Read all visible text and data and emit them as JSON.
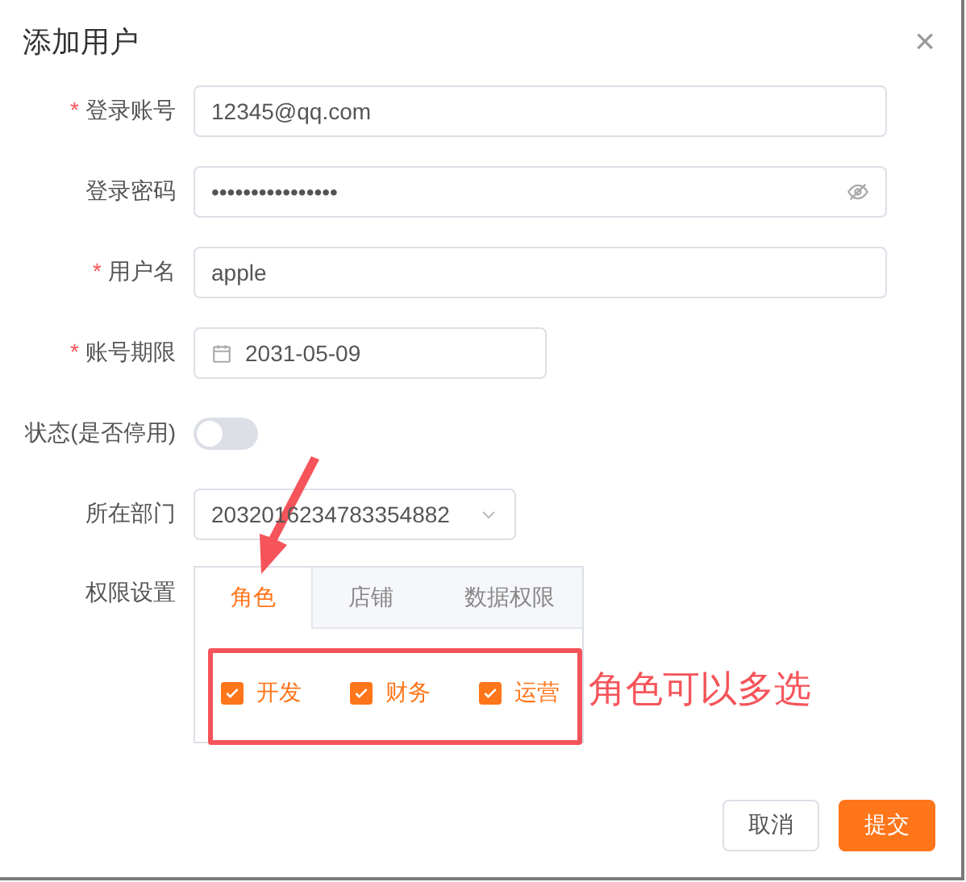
{
  "dialog": {
    "title": "添加用户",
    "close": "×",
    "required_mark": "*"
  },
  "fields": [
    {
      "kind": "text",
      "label": "登录账号",
      "required": true,
      "value": "12345@qq.com"
    },
    {
      "kind": "password",
      "label": "登录密码",
      "required": false,
      "value": "••••••••••••••••"
    },
    {
      "kind": "text",
      "label": "用户名",
      "required": true,
      "value": "apple"
    },
    {
      "kind": "date",
      "label": "账号期限",
      "required": true,
      "value": "2031-05-09"
    },
    {
      "kind": "switch",
      "label": "状态(是否停用)",
      "required": false,
      "on": false
    },
    {
      "kind": "select",
      "label": "所在部门",
      "required": false,
      "value": "2032016234783354882"
    }
  ],
  "permissions": {
    "label": "权限设置",
    "tabs": [
      {
        "label": "角色",
        "selected": true
      },
      {
        "label": "店铺",
        "selected": false
      },
      {
        "label": "数据权限",
        "selected": false
      }
    ],
    "roles": [
      {
        "label": "开发",
        "checked": true
      },
      {
        "label": "财务",
        "checked": true
      },
      {
        "label": "运营",
        "checked": true
      }
    ]
  },
  "annotation": {
    "text": "角色可以多选"
  },
  "buttons": [
    {
      "label": "取消",
      "kind": "secondary"
    },
    {
      "label": "提交",
      "kind": "primary"
    }
  ]
}
